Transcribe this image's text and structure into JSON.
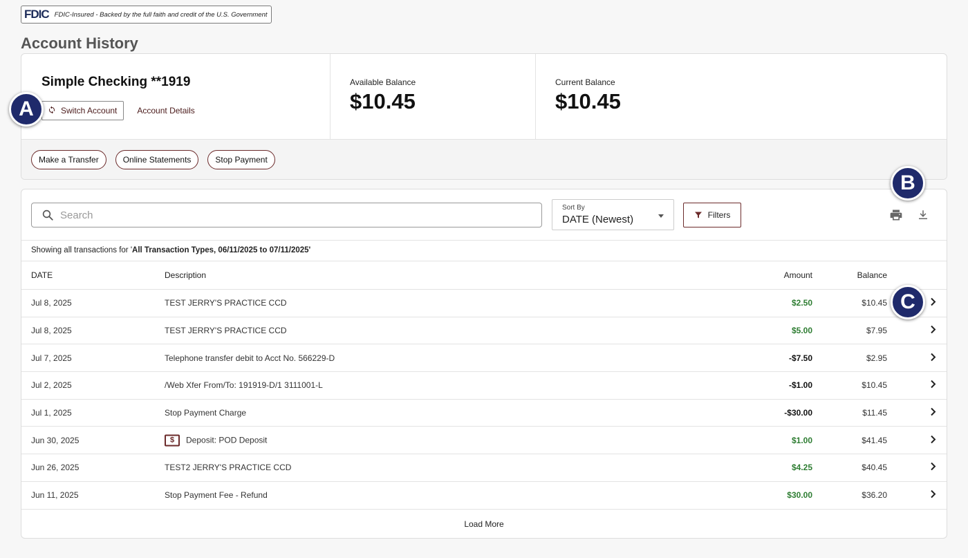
{
  "fdic": {
    "logo": "FDIC",
    "text": "FDIC-Insured - Backed by the full faith and credit of the U.S. Government"
  },
  "page_title": "Account History",
  "account": {
    "name": "Simple Checking **1919",
    "switch_label": "Switch Account",
    "details_label": "Account Details",
    "available_label": "Available Balance",
    "available_value": "$10.45",
    "current_label": "Current Balance",
    "current_value": "$10.45"
  },
  "actions": [
    "Make a Transfer",
    "Online Statements",
    "Stop Payment"
  ],
  "markers": [
    "A",
    "B",
    "C"
  ],
  "toolbar": {
    "search_placeholder": "Search",
    "sort_label": "Sort By",
    "sort_value": "DATE (Newest)",
    "filters_label": "Filters"
  },
  "showing": {
    "prefix": "Showing all transactions for '",
    "criteria": "All Transaction Types, 06/11/2025 to 07/11/2025",
    "suffix": "'"
  },
  "table": {
    "headers": {
      "date": "DATE",
      "description": "Description",
      "amount": "Amount",
      "balance": "Balance"
    },
    "rows": [
      {
        "date": "Jul 8, 2025",
        "description": "TEST JERRY'S PRACTICE CCD",
        "amount": "$2.50",
        "balance": "$10.45",
        "type": "credit"
      },
      {
        "date": "Jul 8, 2025",
        "description": "TEST JERRY'S PRACTICE CCD",
        "amount": "$5.00",
        "balance": "$7.95",
        "type": "credit"
      },
      {
        "date": "Jul 7, 2025",
        "description": "Telephone transfer debit to Acct No. 566229-D",
        "amount": "-$7.50",
        "balance": "$2.95",
        "type": "debit"
      },
      {
        "date": "Jul 2, 2025",
        "description": "/Web Xfer From/To: 191919-D/1 3111001-L",
        "amount": "-$1.00",
        "balance": "$10.45",
        "type": "debit"
      },
      {
        "date": "Jul 1, 2025",
        "description": "Stop Payment Charge",
        "amount": "-$30.00",
        "balance": "$11.45",
        "type": "debit"
      },
      {
        "date": "Jun 30, 2025",
        "description": "Deposit: POD Deposit",
        "amount": "$1.00",
        "balance": "$41.45",
        "type": "credit",
        "icon": "deposit-icon",
        "icon_glyph": "$"
      },
      {
        "date": "Jun 26, 2025",
        "description": "TEST2 JERRY'S PRACTICE CCD",
        "amount": "$4.25",
        "balance": "$40.45",
        "type": "credit"
      },
      {
        "date": "Jun 11, 2025",
        "description": "Stop Payment Fee - Refund",
        "amount": "$30.00",
        "balance": "$36.20",
        "type": "credit"
      }
    ]
  },
  "load_more": "Load More",
  "colors": {
    "brand": "#6b2a2a",
    "marker": "#1f2a6b",
    "credit": "#2e7d32",
    "fdic_logo": "#1c2b59"
  }
}
